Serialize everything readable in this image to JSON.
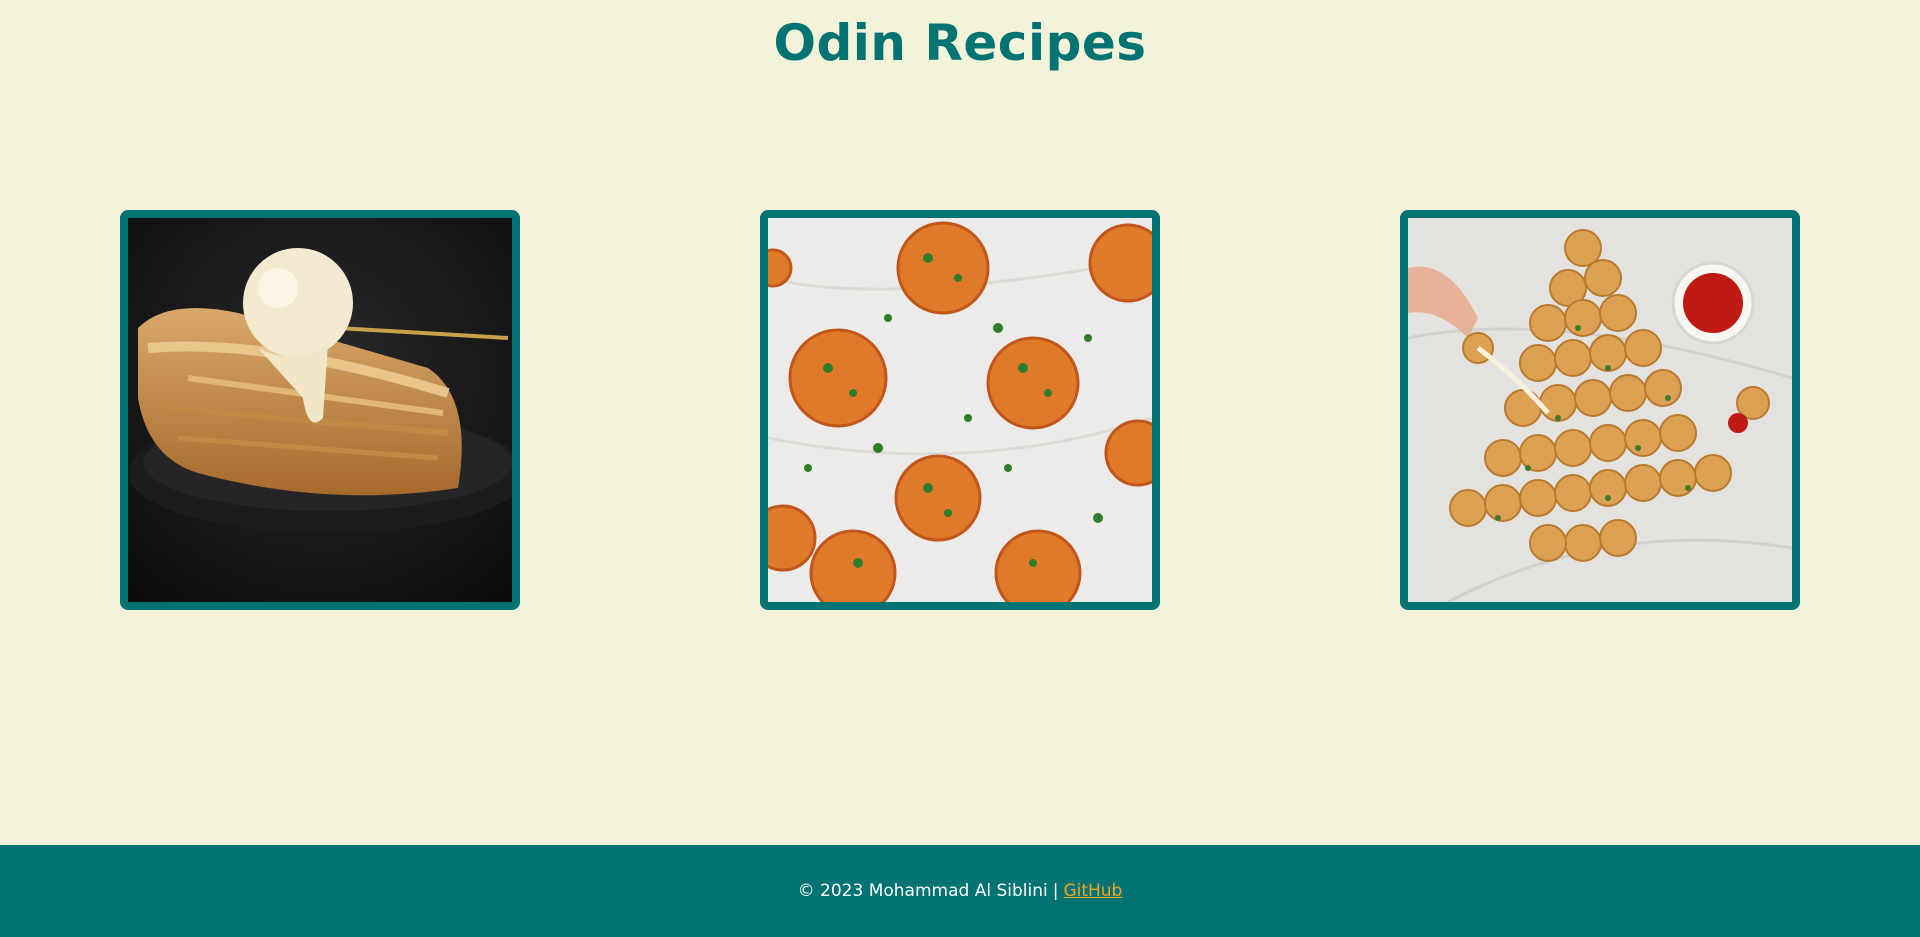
{
  "header": {
    "title": "Odin Recipes"
  },
  "recipes": [
    {
      "image": "apple-pie-with-ice-cream"
    },
    {
      "image": "cheese-meatballs"
    },
    {
      "image": "pull-apart-bread-tree"
    }
  ],
  "footer": {
    "copyright": "© 2023 Mohammad Al Siblini",
    "separator": "|",
    "link_label": "GitHub"
  },
  "colors": {
    "background": "#f3f3d9",
    "accent": "#007372",
    "link": "#f5a623"
  }
}
